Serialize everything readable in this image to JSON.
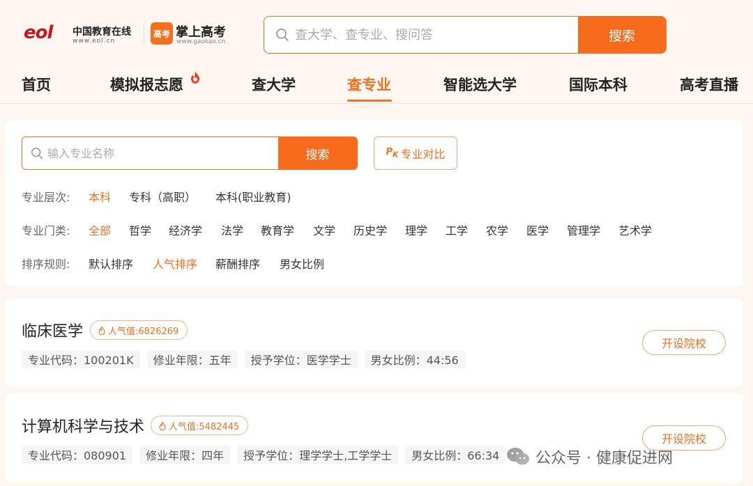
{
  "header": {
    "eol_mark": "eol",
    "eol_name": "中国教育在线",
    "eol_url": "www.eol.cn",
    "gk_badge": "高考",
    "gk_name": "掌上高考",
    "gk_url": "www.gaokao.cn",
    "search_placeholder": "查大学、查专业、搜问答",
    "search_button": "搜索"
  },
  "nav": {
    "items": [
      {
        "label": "首页",
        "active": false
      },
      {
        "label": "模拟报志愿",
        "active": false,
        "badge": "hot-flame-icon"
      },
      {
        "label": "查大学",
        "active": false
      },
      {
        "label": "查专业",
        "active": true
      },
      {
        "label": "智能选大学",
        "active": false
      },
      {
        "label": "国际本科",
        "active": false
      },
      {
        "label": "高考直播",
        "active": false
      }
    ]
  },
  "filters": {
    "search_placeholder": "输入专业名称",
    "search_button": "搜索",
    "compare_icon": "P",
    "compare_icon_sub": "K",
    "compare_label": "专业对比",
    "level": {
      "label": "专业层次:",
      "options": [
        "本科",
        "专科（高职）",
        "本科(职业教育)"
      ],
      "selected": "本科"
    },
    "category": {
      "label": "专业门类:",
      "options": [
        "全部",
        "哲学",
        "经济学",
        "法学",
        "教育学",
        "文学",
        "历史学",
        "理学",
        "工学",
        "农学",
        "医学",
        "管理学",
        "艺术学"
      ],
      "selected": "全部"
    },
    "sort": {
      "label": "排序规则:",
      "options": [
        "默认排序",
        "人气排序",
        "薪酬排序",
        "男女比例"
      ],
      "selected": "人气排序"
    }
  },
  "majors": [
    {
      "name": "临床医学",
      "popularity": "人气值:6826269",
      "tags": [
        "专业代码：100201K",
        "修业年限：五年",
        "授予学位：医学学士",
        "男女比例：44:56"
      ],
      "button": "开设院校"
    },
    {
      "name": "计算机科学与技术",
      "popularity": "人气值:5482445",
      "tags": [
        "专业代码：080901",
        "修业年限：四年",
        "授予学位：理学学士,工学学士",
        "男女比例：66:34"
      ],
      "button": "开设院校"
    }
  ],
  "watermark": {
    "text": "公众号 · 健康促进网"
  },
  "colors": {
    "accent": "#f37021",
    "button": "#f76b1c",
    "page_bg": "#fdf6f1"
  }
}
